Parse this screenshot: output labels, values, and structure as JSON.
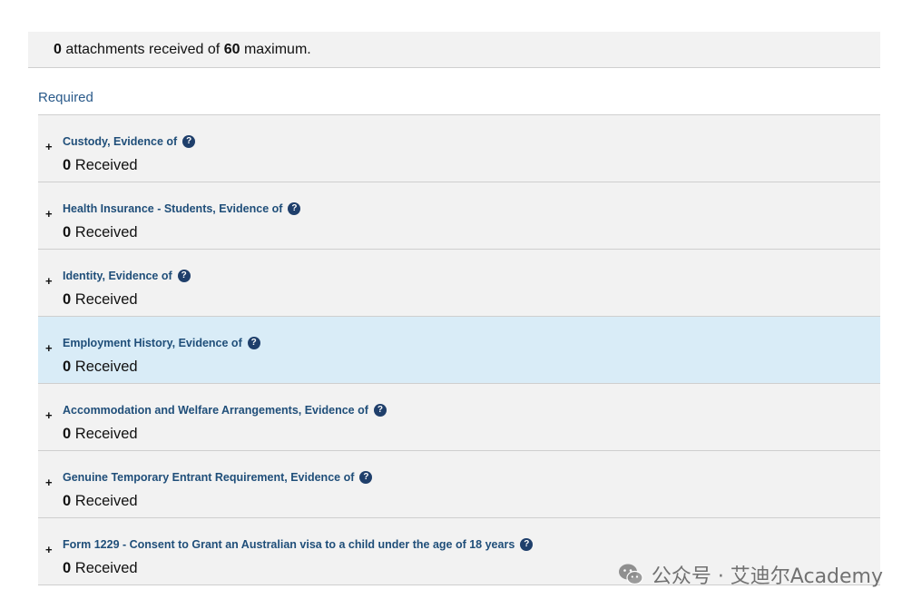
{
  "summary": {
    "received_count": "0",
    "text_middle": "attachments received of",
    "maximum": "60",
    "text_end": "maximum."
  },
  "section": {
    "label": "Required"
  },
  "items": [
    {
      "title": "Custody, Evidence of",
      "count": "0",
      "status": "Received"
    },
    {
      "title": "Health Insurance - Students, Evidence of",
      "count": "0",
      "status": "Received"
    },
    {
      "title": "Identity, Evidence of",
      "count": "0",
      "status": "Received"
    },
    {
      "title": "Employment History, Evidence of",
      "count": "0",
      "status": "Received"
    },
    {
      "title": "Accommodation and Welfare Arrangements, Evidence of",
      "count": "0",
      "status": "Received"
    },
    {
      "title": "Genuine Temporary Entrant Requirement, Evidence of",
      "count": "0",
      "status": "Received"
    },
    {
      "title": "Form 1229 - Consent to Grant an Australian visa to a child under the age of 18 years",
      "count": "0",
      "status": "Received"
    }
  ],
  "ui": {
    "expand_symbol": "+",
    "help_symbol": "?",
    "highlight_color": "#d9ecf7",
    "link_color": "#1f4e79",
    "icons": {
      "expand": "plus-icon",
      "help": "help-circle-icon",
      "watermark": "wechat-icon"
    }
  },
  "watermark": {
    "text": "公众号 · 艾迪尔Academy"
  }
}
